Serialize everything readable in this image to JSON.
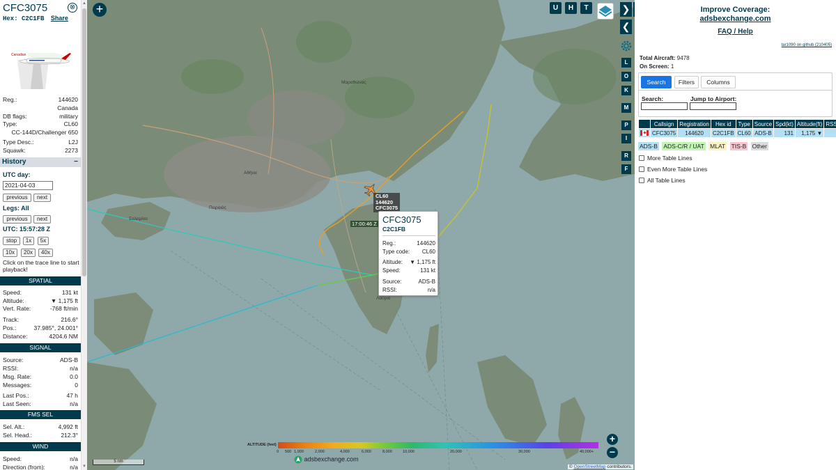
{
  "sidebar": {
    "callsign": "CFC3075",
    "close_glyph": "⊗",
    "hex_label": "Hex:",
    "hex": "C2C1FB",
    "share": "Share",
    "operator_logo_text": "Canadian",
    "info": [
      {
        "k": "Reg.:",
        "v": "144620"
      },
      {
        "k": "",
        "v": "Canada"
      },
      {
        "k": "DB flags:",
        "v": "military"
      },
      {
        "k": "Type:",
        "v": "CL60"
      }
    ],
    "type_name": "CC-144D/Challenger 650",
    "info2": [
      {
        "k": "Type Desc.:",
        "v": "L2J"
      },
      {
        "k": "Squawk:",
        "v": "2273"
      }
    ],
    "history": {
      "title": "History",
      "collapse_glyph": "−",
      "utc_day_label": "UTC day:",
      "date_value": "2021-04-03",
      "previous": "previous",
      "next": "next",
      "legs_label": "Legs: All",
      "utc_time_label": "UTC: 15:57:28 Z",
      "stop": "stop",
      "speeds": [
        "1x",
        "5x",
        "10x",
        "20x",
        "40x"
      ],
      "note": "Click on the trace line to start playback!"
    },
    "spatial": {
      "title": "SPATIAL",
      "rows": [
        {
          "k": "Speed:",
          "v": "131 kt"
        },
        {
          "k": "Altitude:",
          "v": "▼ 1,175 ft"
        },
        {
          "k": "Vert. Rate:",
          "v": "-768 ft/min"
        },
        {
          "k": "Track:",
          "v": "216.6°"
        },
        {
          "k": "Pos.:",
          "v": "37.985°, 24.001°"
        },
        {
          "k": "Distance:",
          "v": "4204.6 NM"
        }
      ]
    },
    "signal": {
      "title": "SIGNAL",
      "rows": [
        {
          "k": "Source:",
          "v": "ADS-B"
        },
        {
          "k": "RSSI:",
          "v": "n/a"
        },
        {
          "k": "Msg. Rate:",
          "v": "0.0"
        },
        {
          "k": "Messages:",
          "v": "0"
        },
        {
          "k": "Last Pos.:",
          "v": "47 h"
        },
        {
          "k": "Last Seen:",
          "v": "n/a"
        }
      ]
    },
    "fms": {
      "title": "FMS SEL",
      "rows": [
        {
          "k": "Sel. Alt.:",
          "v": "4,992 ft"
        },
        {
          "k": "Sel. Head.:",
          "v": "212.3°"
        }
      ]
    },
    "wind": {
      "title": "WIND",
      "rows": [
        {
          "k": "Speed:",
          "v": "n/a"
        },
        {
          "k": "Direction (from):",
          "v": "n/a"
        }
      ]
    }
  },
  "map": {
    "plus_glyph": "+",
    "top_buttons": [
      "U",
      "H",
      "T"
    ],
    "side_buttons": [
      "L",
      "O",
      "K",
      "M",
      "P",
      "I",
      "R",
      "F"
    ],
    "forward_glyph": "❯",
    "back_glyph": "❮",
    "expand_glyph": "◂▸",
    "ac_label_lines": [
      "CL60",
      "144620",
      "CFC3075"
    ],
    "time_label": "17:00:46 Z",
    "popup": {
      "callsign": "CFC3075",
      "hex": "C2C1FB",
      "rows": [
        {
          "k": "Reg.:",
          "v": "144620"
        },
        {
          "k": "Type code:",
          "v": "CL60"
        },
        {
          "k": "Altitude:",
          "v": "▼ 1,175 ft"
        },
        {
          "k": "Speed:",
          "v": "131 kt"
        },
        {
          "k": "Source:",
          "v": "ADS-B"
        },
        {
          "k": "RSSI:",
          "v": "n/a"
        }
      ]
    },
    "altitude_legend": {
      "title": "ALTITUDE (feet)",
      "ticks": [
        "0",
        "500",
        "1,000",
        "2,000",
        "4,000",
        "6,000",
        "8,000",
        "10,000",
        "20,000",
        "30,000",
        "40,000+"
      ]
    },
    "brand": "adsbexchange.com",
    "scale": "5 nm",
    "zoom_in": "+",
    "zoom_out": "−",
    "attribution_prefix": "©",
    "attribution_link": "OpenStreetMap",
    "attribution_suffix": "contributors.",
    "place_labels": [
      "Αθήνα",
      "Πειραιάς",
      "Σαλαμίνα",
      "Μαραθώνας",
      "Λαύριο"
    ],
    "colors": {
      "sea": "#8fa9ab",
      "land": "#7a8b78",
      "brand": "#003a4d",
      "aircraft": "#e8913a"
    }
  },
  "right": {
    "improve": "Improve Coverage:",
    "exchange": "adsbexchange.com",
    "faq": "FAQ / Help",
    "version": "tar1090 on github (210405)",
    "total_label": "Total Aircraft:",
    "total": "9478",
    "onscreen_label": "On Screen:",
    "onscreen": "1",
    "tabs": [
      "Search",
      "Filters",
      "Columns"
    ],
    "search_label": "Search:",
    "jump_label": "Jump to Airport:",
    "table": {
      "headers": [
        "",
        "Callsign",
        "Registration",
        "Hex id",
        "Type",
        "Source",
        "Spd(kt)",
        "Altitude(ft)",
        "RSSI"
      ],
      "row": [
        "",
        "CFC3075",
        "144620",
        "C2C1FB",
        "CL60",
        "ADS-B",
        "131",
        "1,175 ▼",
        ""
      ]
    },
    "sources": [
      {
        "label": "ADS-B",
        "bg": "#b4e0f5"
      },
      {
        "label": "ADS-C/R / UAT",
        "bg": "#c2f5b4"
      },
      {
        "label": "MLAT",
        "bg": "#fbf2c2"
      },
      {
        "label": "TIS-B",
        "bg": "#f8c4d2"
      },
      {
        "label": "Other",
        "bg": "#dcdcdc"
      }
    ],
    "checkboxes": [
      "More Table Lines",
      "Even More Table Lines",
      "All Table Lines"
    ]
  }
}
